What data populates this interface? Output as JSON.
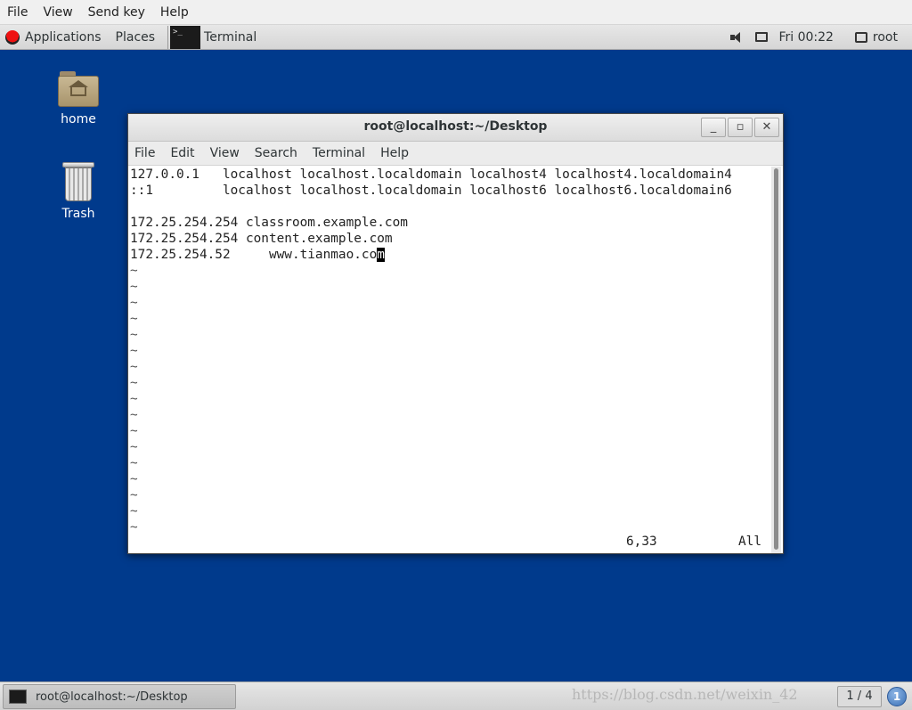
{
  "viewer_menu": [
    "File",
    "View",
    "Send key",
    "Help"
  ],
  "top_panel": {
    "applications": "Applications",
    "places": "Places",
    "task": "Terminal",
    "clock": "Fri 00:22",
    "user": "root"
  },
  "desktop_icons": {
    "home": "home",
    "trash": "Trash"
  },
  "terminal": {
    "title": "root@localhost:~/Desktop",
    "menu": [
      "File",
      "Edit",
      "View",
      "Search",
      "Terminal",
      "Help"
    ],
    "lines": [
      "127.0.0.1   localhost localhost.localdomain localhost4 localhost4.localdomain4",
      "::1         localhost localhost.localdomain localhost6 localhost6.localdomain6",
      "",
      "172.25.254.254 classroom.example.com",
      "172.25.254.254 content.example.com",
      "172.25.254.52     www.tianmao.co"
    ],
    "cursor_char": "m",
    "tilde": "~",
    "status_position": "6,33",
    "status_view": "All"
  },
  "bottom_panel": {
    "task_label": "root@localhost:~/Desktop",
    "watermark": "https://blog.csdn.net/weixin_42",
    "workspace": "1 / 4",
    "notify": "1"
  }
}
